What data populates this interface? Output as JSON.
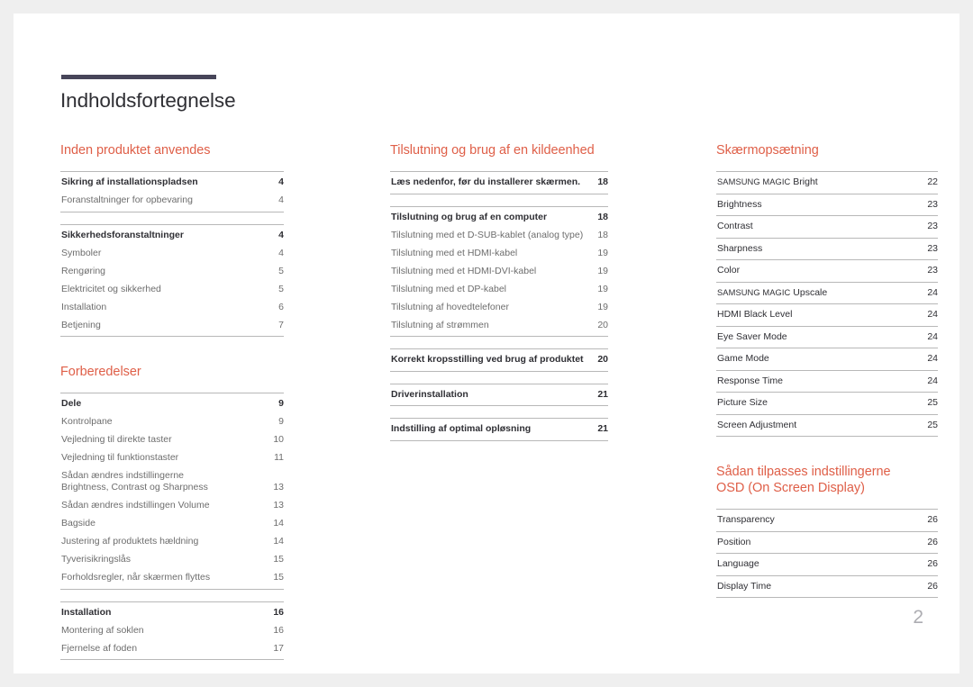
{
  "document": {
    "title": "Indholdsfortegnelse",
    "folio": "2",
    "accent_color": "#df5f48",
    "rule_color": "#474559",
    "text_color": "#2f2f34",
    "muted_text_color": "#6d6d6d",
    "page_background": "#ffffff",
    "canvas_background": "#efefef"
  },
  "columns": [
    {
      "id": "column-1",
      "sections": [
        {
          "heading": "Inden produktet anvendes",
          "groups": [
            {
              "rows": [
                {
                  "label": "Sikring af installationspladsen",
                  "page": "4",
                  "style": "bold"
                },
                {
                  "label": "Foranstaltninger for opbevaring",
                  "page": "4",
                  "style": "sub"
                }
              ]
            },
            {
              "spaced": true,
              "rows": [
                {
                  "label": "Sikkerhedsforanstaltninger",
                  "page": "4",
                  "style": "bold"
                },
                {
                  "label": "Symboler",
                  "page": "4",
                  "style": "sub"
                },
                {
                  "label": "Rengøring",
                  "page": "5",
                  "style": "sub"
                },
                {
                  "label": "Elektricitet og sikkerhed",
                  "page": "5",
                  "style": "sub"
                },
                {
                  "label": "Installation",
                  "page": "6",
                  "style": "sub"
                },
                {
                  "label": "Betjening",
                  "page": "7",
                  "style": "sub"
                }
              ]
            }
          ]
        },
        {
          "heading": "Forberedelser",
          "gap_before": true,
          "groups": [
            {
              "rows": [
                {
                  "label": "Dele",
                  "page": "9",
                  "style": "bold"
                },
                {
                  "label": "Kontrolpane",
                  "page": "9",
                  "style": "sub"
                },
                {
                  "label": "Vejledning til direkte taster",
                  "page": "10",
                  "style": "sub"
                },
                {
                  "label": "Vejledning til funktionstaster",
                  "page": "11",
                  "style": "sub"
                },
                {
                  "label": "Sådan ændres indstillingerne\nBrightness, Contrast og Sharpness",
                  "page": "13",
                  "style": "sub",
                  "wrapped": true
                },
                {
                  "label": "Sådan ændres indstillingen Volume",
                  "page": "13",
                  "style": "sub"
                },
                {
                  "label": "Bagside",
                  "page": "14",
                  "style": "sub"
                },
                {
                  "label": "Justering af produktets hældning",
                  "page": "14",
                  "style": "sub"
                },
                {
                  "label": "Tyverisikringslås",
                  "page": "15",
                  "style": "sub"
                },
                {
                  "label": "Forholdsregler, når skærmen flyttes",
                  "page": "15",
                  "style": "sub"
                }
              ]
            },
            {
              "spaced": true,
              "rows": [
                {
                  "label": "Installation",
                  "page": "16",
                  "style": "bold"
                },
                {
                  "label": "Montering af soklen",
                  "page": "16",
                  "style": "sub"
                },
                {
                  "label": "Fjernelse af foden",
                  "page": "17",
                  "style": "sub"
                }
              ]
            }
          ]
        }
      ]
    },
    {
      "id": "column-2",
      "sections": [
        {
          "heading": "Tilslutning og brug af en kildeenhed",
          "groups": [
            {
              "rows": [
                {
                  "label": "Læs nedenfor, før du installerer skærmen.",
                  "page": "18",
                  "style": "bold"
                }
              ]
            },
            {
              "spaced": true,
              "rows": [
                {
                  "label": "Tilslutning og brug af en computer",
                  "page": "18",
                  "style": "bold"
                },
                {
                  "label": "Tilslutning med et D-SUB-kablet (analog type)",
                  "page": "18",
                  "style": "sub"
                },
                {
                  "label": "Tilslutning med et HDMI-kabel",
                  "page": "19",
                  "style": "sub"
                },
                {
                  "label": "Tilslutning med et HDMI-DVI-kabel",
                  "page": "19",
                  "style": "sub"
                },
                {
                  "label": "Tilslutning med et DP-kabel",
                  "page": "19",
                  "style": "sub"
                },
                {
                  "label": "Tilslutning af hovedtelefoner",
                  "page": "19",
                  "style": "sub"
                },
                {
                  "label": "Tilslutning af strømmen",
                  "page": "20",
                  "style": "sub"
                }
              ]
            },
            {
              "spaced": true,
              "rows": [
                {
                  "label": "Korrekt kropsstilling ved brug af produktet",
                  "page": "20",
                  "style": "bold"
                }
              ]
            },
            {
              "spaced": true,
              "rows": [
                {
                  "label": "Driverinstallation",
                  "page": "21",
                  "style": "bold"
                }
              ]
            },
            {
              "spaced": true,
              "rows": [
                {
                  "label": "Indstilling af optimal opløsning",
                  "page": "21",
                  "style": "bold"
                }
              ]
            }
          ]
        }
      ]
    },
    {
      "id": "column-3",
      "sections": [
        {
          "heading": "Skærmopsætning",
          "groups": [
            {
              "rows": [
                {
                  "label": "SAMSUNG MAGIC Bright",
                  "page": "22",
                  "style": "plain",
                  "brand_prefix": "SAMSUNG MAGIC"
                }
              ]
            },
            {
              "rows": [
                {
                  "label": "Brightness",
                  "page": "23",
                  "style": "plain"
                }
              ]
            },
            {
              "rows": [
                {
                  "label": "Contrast",
                  "page": "23",
                  "style": "plain"
                }
              ]
            },
            {
              "rows": [
                {
                  "label": "Sharpness",
                  "page": "23",
                  "style": "plain"
                }
              ]
            },
            {
              "rows": [
                {
                  "label": "Color",
                  "page": "23",
                  "style": "plain"
                }
              ]
            },
            {
              "rows": [
                {
                  "label": "SAMSUNG MAGIC Upscale",
                  "page": "24",
                  "style": "plain",
                  "brand_prefix": "SAMSUNG MAGIC"
                }
              ]
            },
            {
              "rows": [
                {
                  "label": "HDMI Black Level",
                  "page": "24",
                  "style": "plain"
                }
              ]
            },
            {
              "rows": [
                {
                  "label": "Eye Saver Mode",
                  "page": "24",
                  "style": "plain"
                }
              ]
            },
            {
              "rows": [
                {
                  "label": "Game Mode",
                  "page": "24",
                  "style": "plain"
                }
              ]
            },
            {
              "rows": [
                {
                  "label": "Response Time",
                  "page": "24",
                  "style": "plain"
                }
              ]
            },
            {
              "rows": [
                {
                  "label": "Picture Size",
                  "page": "25",
                  "style": "plain"
                }
              ]
            },
            {
              "rows": [
                {
                  "label": "Screen Adjustment",
                  "page": "25",
                  "style": "plain"
                }
              ]
            }
          ]
        },
        {
          "heading": "Sådan tilpasses indstillingerne\nOSD (On Screen Display)",
          "gap_before": true,
          "groups": [
            {
              "rows": [
                {
                  "label": "Transparency",
                  "page": "26",
                  "style": "plain"
                }
              ]
            },
            {
              "rows": [
                {
                  "label": "Position",
                  "page": "26",
                  "style": "plain"
                }
              ]
            },
            {
              "rows": [
                {
                  "label": "Language",
                  "page": "26",
                  "style": "plain"
                }
              ]
            },
            {
              "rows": [
                {
                  "label": "Display Time",
                  "page": "26",
                  "style": "plain"
                }
              ]
            }
          ]
        }
      ]
    }
  ]
}
